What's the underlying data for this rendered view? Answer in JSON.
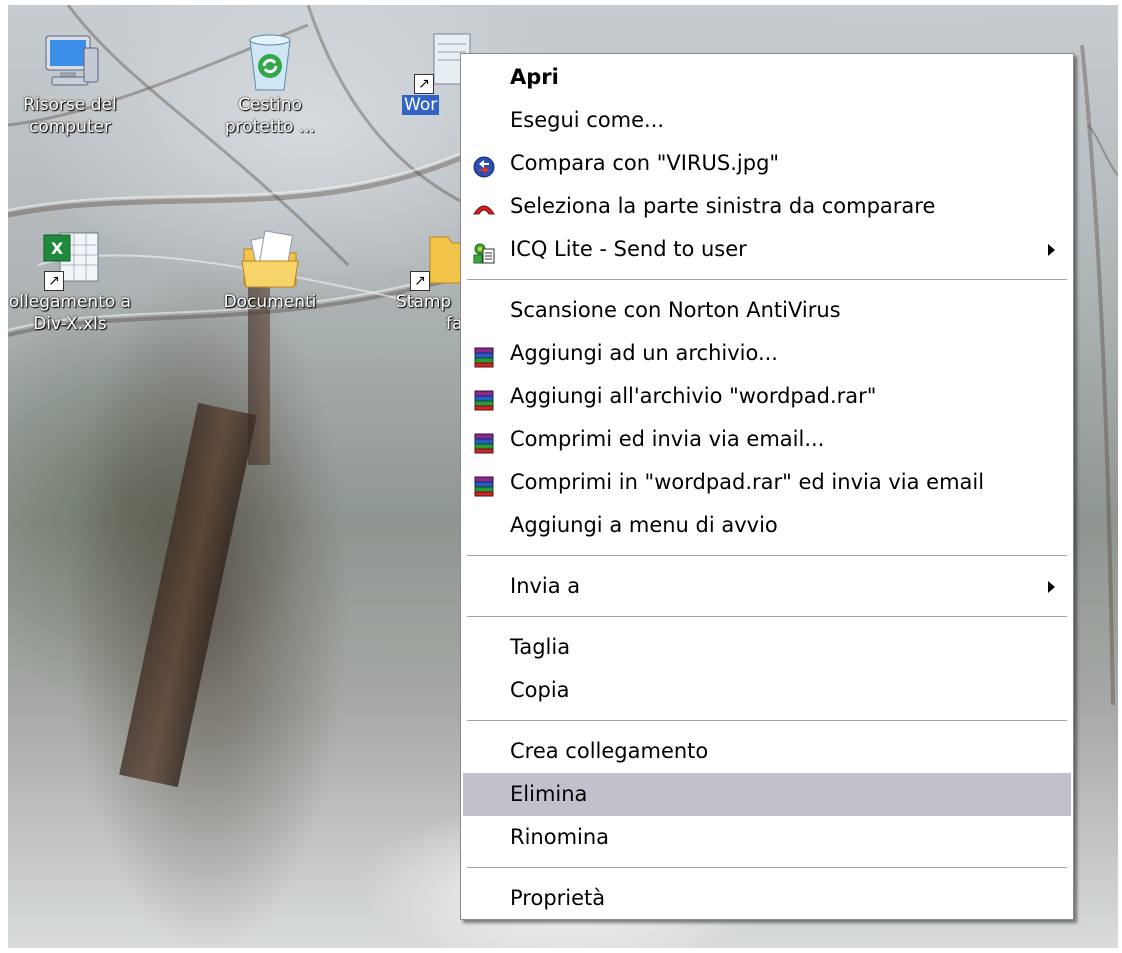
{
  "desktop": {
    "icons": [
      {
        "name": "my-computer",
        "line1": "Risorse del",
        "line2": "computer",
        "icon": "computer-icon"
      },
      {
        "name": "recycle-bin",
        "line1": "Cestino",
        "line2": "protetto ...",
        "icon": "recycle-bin-icon"
      },
      {
        "name": "wordpad",
        "line1": "Wor",
        "line2": "",
        "icon": "wordpad-icon"
      },
      {
        "name": "excel-shortcut",
        "line1": "ollegamento a",
        "line2": "Div-X.xls",
        "icon": "excel-icon"
      },
      {
        "name": "documents",
        "line1": "Documenti",
        "line2": "",
        "icon": "documents-icon"
      },
      {
        "name": "printers",
        "line1": "Stamp",
        "line2": "fa",
        "icon": "folder-icon"
      }
    ]
  },
  "menu": {
    "groups": [
      [
        {
          "label": "Apri",
          "bold": true
        },
        {
          "label": "Esegui come..."
        },
        {
          "label": "Compara con \"VIRUS.jpg\"",
          "icon": "compare-icon"
        },
        {
          "label": "Seleziona la parte sinistra da comparare",
          "icon": "select-left-icon"
        },
        {
          "label": "ICQ Lite - Send to user",
          "icon": "icq-icon",
          "submenu": true
        }
      ],
      [
        {
          "label": "Scansione con Norton AntiVirus"
        },
        {
          "label": "Aggiungi ad un archivio...",
          "icon": "winrar-icon"
        },
        {
          "label": "Aggiungi all'archivio \"wordpad.rar\"",
          "icon": "winrar-icon"
        },
        {
          "label": "Comprimi ed invia via email...",
          "icon": "winrar-icon"
        },
        {
          "label": "Comprimi in \"wordpad.rar\" ed invia via email",
          "icon": "winrar-icon"
        },
        {
          "label": "Aggiungi a menu di avvio"
        }
      ],
      [
        {
          "label": "Invia a",
          "submenu": true
        }
      ],
      [
        {
          "label": "Taglia"
        },
        {
          "label": "Copia"
        }
      ],
      [
        {
          "label": "Crea collegamento"
        },
        {
          "label": "Elimina",
          "highlighted": true
        },
        {
          "label": "Rinomina"
        }
      ],
      [
        {
          "label": "Proprietà"
        }
      ]
    ]
  }
}
